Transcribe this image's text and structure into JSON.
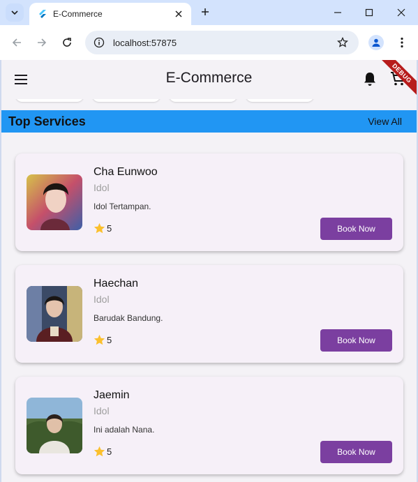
{
  "browser": {
    "tab_title": "E-Commerce",
    "url": "localhost:57875"
  },
  "app": {
    "title": "E-Commerce",
    "debug_label": "DEBUG"
  },
  "section": {
    "title": "Top Services",
    "view_all": "View All"
  },
  "services": [
    {
      "name": "Cha Eunwoo",
      "role": "Idol",
      "description": "Idol Tertampan.",
      "rating": "5",
      "button": "Book Now"
    },
    {
      "name": "Haechan",
      "role": "Idol",
      "description": "Barudak Bandung.",
      "rating": "5",
      "button": "Book Now"
    },
    {
      "name": "Jaemin",
      "role": "Idol",
      "description": "Ini adalah Nana.",
      "rating": "5",
      "button": "Book Now"
    }
  ],
  "colors": {
    "section_bar": "#2196f3",
    "button": "#7b3fa0",
    "card": "#f6f0f8",
    "star": "#fbc02d"
  }
}
